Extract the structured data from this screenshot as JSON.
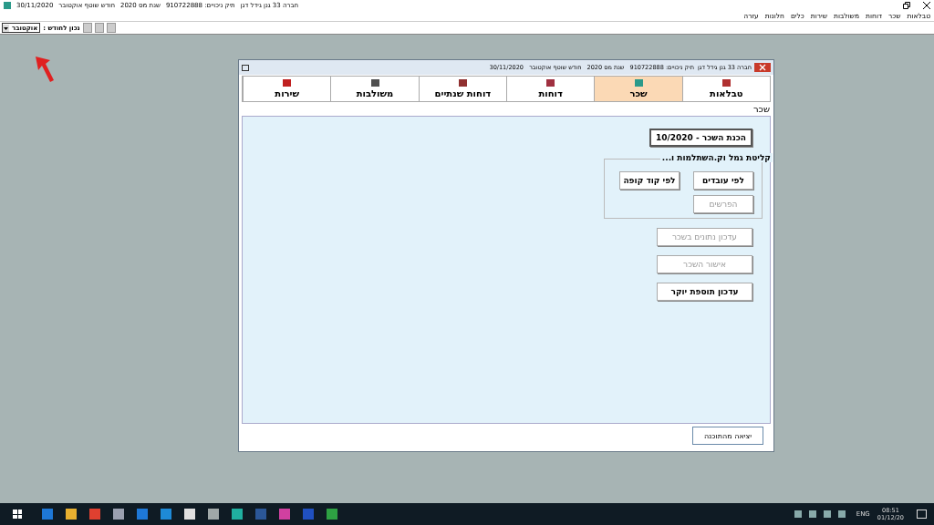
{
  "app_title": {
    "company": "חברה 33 גנן גידל דגן",
    "tax_file": "תיק ניכויים: 910722888",
    "tax_year": "שנת מס 2020",
    "month": "חודש שוטף אוקטובר",
    "date": "30/11/2020"
  },
  "menu": [
    "טבלאות",
    "שכר",
    "דוחות",
    "משולבות",
    "שירות",
    "כלים",
    "חלונות",
    "עזרה"
  ],
  "toolbar": {
    "month_label": "נכון לחודש :",
    "month_value": "אוקטובר"
  },
  "window": {
    "company": "חברה 33 גנן גידל דגן",
    "tax_file": "תיק ניכויים: 910722888",
    "tax_year": "שנת מס 2020",
    "month": "חודש שוטף אוקטובר",
    "date": "30/11/2020"
  },
  "tabs": [
    {
      "label": "טבלאות",
      "selected": false,
      "color": "#b03030"
    },
    {
      "label": "שכר",
      "selected": true,
      "color": "#2a9a8a"
    },
    {
      "label": "דוחות",
      "selected": false,
      "color": "#a03040"
    },
    {
      "label": "דוחות שנתיים",
      "selected": false,
      "color": "#903030"
    },
    {
      "label": "משולבות",
      "selected": false,
      "color": "#505050"
    },
    {
      "label": "שירות",
      "selected": false,
      "color": "#c02020"
    }
  ],
  "section_title": "שכר",
  "main_button": "הכנת השכר - 10/2020",
  "group": {
    "title": "קליטת גמל וק.השתלמות ו...",
    "buttons": [
      {
        "label": "לפי עובדים",
        "disabled": false
      },
      {
        "label": "לפי קוד קופה",
        "disabled": false
      },
      {
        "label": "הפרשים",
        "disabled": true
      }
    ]
  },
  "actions": [
    {
      "label": "עדכון נתונים בשכר",
      "disabled": true
    },
    {
      "label": "אישור השכר",
      "disabled": true
    },
    {
      "label": "עדכון תוספת יוקר",
      "disabled": false
    }
  ],
  "exit_button": "יציאה מהתוכנה",
  "taskbar": {
    "apps": [
      {
        "color": "#1e78d7"
      },
      {
        "color": "#e8b030"
      },
      {
        "color": "#e04030"
      },
      {
        "color": "#9aa0b0"
      },
      {
        "color": "#1e78d7"
      },
      {
        "color": "#1e8ad7"
      },
      {
        "color": "#e0e0e0"
      },
      {
        "color": "#a0a8a8"
      },
      {
        "color": "#20b0a0"
      },
      {
        "color": "#2b5797"
      },
      {
        "color": "#d040a0"
      },
      {
        "color": "#2050c0"
      },
      {
        "color": "#2ea043"
      }
    ],
    "language": "ENG",
    "time": "08:51",
    "date": "01/12/20"
  }
}
